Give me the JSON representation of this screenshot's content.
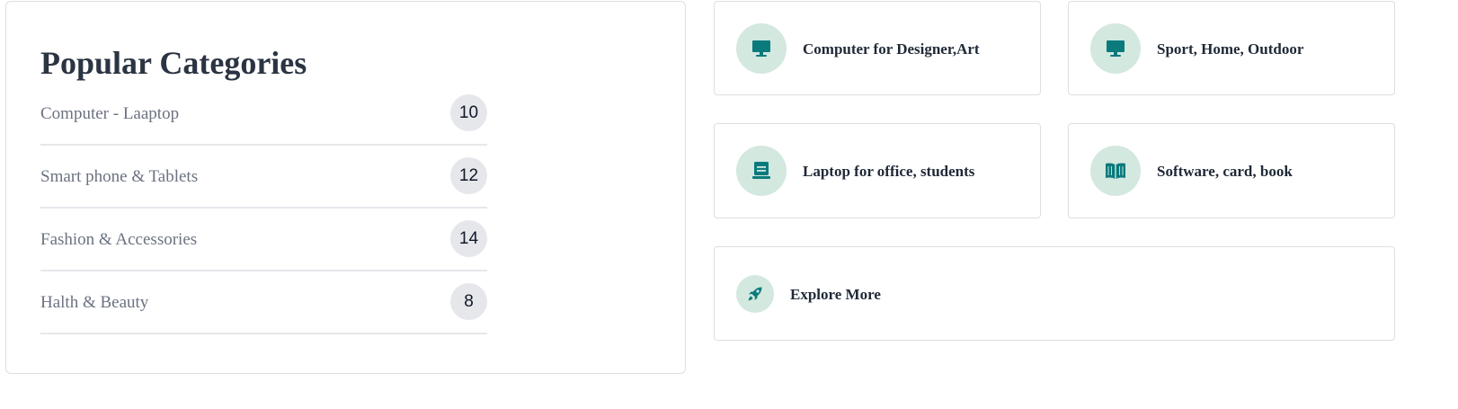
{
  "popular": {
    "title": "Popular Categories",
    "items": [
      {
        "label": "Computer - Laaptop",
        "count": "10"
      },
      {
        "label": "Smart phone & Tablets",
        "count": "12"
      },
      {
        "label": "Fashion & Accessories",
        "count": "14"
      },
      {
        "label": "Halth & Beauty",
        "count": "8"
      }
    ]
  },
  "tiles": [
    {
      "title": "Computer for Designer,Art",
      "icon": "monitor-icon"
    },
    {
      "title": "Sport, Home, Outdoor",
      "icon": "monitor-icon"
    },
    {
      "title": "Laptop for office, students",
      "icon": "laptop-icon"
    },
    {
      "title": "Software, card, book",
      "icon": "book-icon"
    }
  ],
  "explore": {
    "title": "Explore More",
    "icon": "rocket-icon"
  },
  "colors": {
    "accent": "#0b7a7d",
    "icon_bg": "#d3e8df",
    "border": "#dcdfe4"
  }
}
